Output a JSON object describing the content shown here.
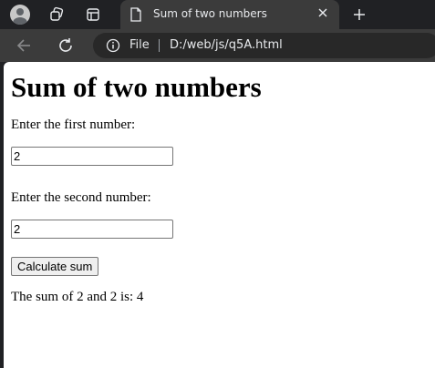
{
  "browser": {
    "tab": {
      "title": "Sum of two numbers"
    },
    "address": {
      "scheme": "File",
      "url": "D:/web/js/q5A.html"
    }
  },
  "page": {
    "heading": "Sum of two numbers",
    "first_label": "Enter the first number:",
    "first_value": "2",
    "second_label": "Enter the second number:",
    "second_value": "2",
    "button_label": "Calculate sum",
    "result": "The sum of 2 and 2 is: 4"
  }
}
